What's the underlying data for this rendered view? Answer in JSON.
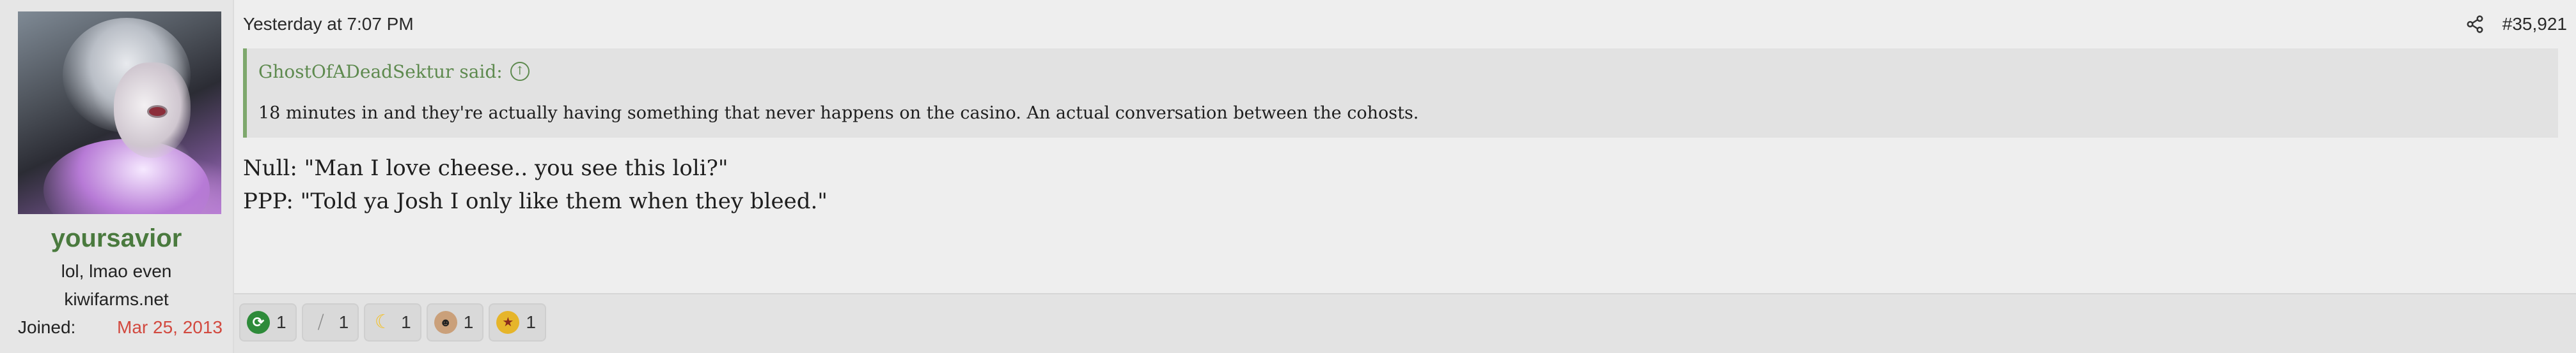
{
  "user": {
    "username": "yoursavior",
    "title": "lol, lmao even",
    "banner": "kiwifarms.net",
    "joined_label": "Joined:",
    "joined_date": "Mar 25, 2013"
  },
  "post": {
    "date": "Yesterday at 7:07 PM",
    "number": "#35,921",
    "quote": {
      "author": "GhostOfADeadSektur said:",
      "text": "18 minutes in and they're actually having something that never happens on the casino. An actual conversation between the cohosts."
    },
    "body": {
      "line1": "Null: \"Man I love cheese.. you see this loli?\"",
      "line2": "PPP: \"Told ya Josh I only like them when they bleed.\""
    }
  },
  "reactions": [
    {
      "icon": "green-arrow-icon",
      "count": "1"
    },
    {
      "icon": "wrench-icon",
      "count": "1"
    },
    {
      "icon": "moon-icon",
      "count": "1"
    },
    {
      "icon": "face-icon",
      "count": "1"
    },
    {
      "icon": "medal-icon",
      "count": "1"
    }
  ],
  "colors": {
    "username": "#4a7a3e",
    "joined_date": "#d2493f",
    "quote_accent": "#7ea86d"
  }
}
